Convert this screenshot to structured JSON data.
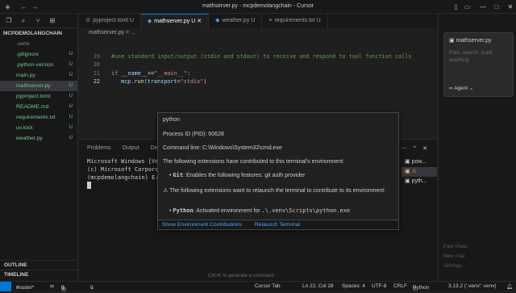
{
  "window": {
    "title": "mathserver.py - mcpdemolangchain - Cursor"
  },
  "sidebar": {
    "header": "MCPDEMOLANGCHAIN",
    "files": [
      {
        "name": ".venv",
        "badge": ""
      },
      {
        "name": ".gitignore",
        "badge": "U"
      },
      {
        "name": ".python-version",
        "badge": "U"
      },
      {
        "name": "main.py",
        "badge": "U"
      },
      {
        "name": "mathserver.py",
        "badge": "U"
      },
      {
        "name": "pyproject.toml",
        "badge": "U"
      },
      {
        "name": "README.md",
        "badge": "U"
      },
      {
        "name": "requirements.txt",
        "badge": "U"
      },
      {
        "name": "uv.lock",
        "badge": "U"
      },
      {
        "name": "weather.py",
        "badge": "U"
      }
    ],
    "outline": "OUTLINE",
    "timeline": "TIMELINE"
  },
  "tabs": [
    {
      "name": "pyproject.toml",
      "badge": "U",
      "icon": "toml"
    },
    {
      "name": "mathserver.py",
      "badge": "U",
      "icon": "py"
    },
    {
      "name": "weather.py",
      "badge": "U",
      "icon": "py"
    },
    {
      "name": "requirements.txt",
      "badge": "U",
      "icon": "txt"
    }
  ],
  "breadcrumb": "mathserver.py > ...",
  "editor": {
    "line_numbers": [
      "19",
      "20",
      "21",
      "22"
    ],
    "comment": "#use standard input/output (stdin and stdout) to receive and respond to tool function calls",
    "line21": {
      "kw": "if",
      "id": "__name__",
      "op": "==",
      "st": "\"__main__\"",
      "end": ":"
    },
    "line22": {
      "id": "mcp",
      "fn": "run",
      "param": "transport",
      "st": "\"stdio\""
    }
  },
  "panel": {
    "tabs": [
      "Problems",
      "Output",
      "Debug"
    ],
    "terminal_lines": [
      "Microsoft Windows [Version",
      "(c) Microsoft Corporation.",
      "",
      "(mcpdemolangchain) E:\\"
    ],
    "terminals": [
      "pow...",
      "cmd",
      "pyth..."
    ]
  },
  "hover": {
    "name": "python",
    "pid": "Process ID (PID): 60628",
    "cmd": "Command line: C:\\Windows\\System32\\cmd.exe",
    "contrib_title": "The following extensions have contributed to this terminal's environment:",
    "git_label": "Git",
    "git_text": ": Enables the following features: git auth provider",
    "relaunch_title": "The following extensions want to relaunch the terminal to contribute to its environment:",
    "python_label": "Python",
    "python_text": ": Activated environment for",
    "python_path": ".\\.venv\\Scripts\\python.exe",
    "link1": "Show Environment Contributions",
    "link2": "Relaunch Terminal"
  },
  "chat": {
    "card_title": "mathserver.py",
    "placeholder": "Plan, search, build anything",
    "agent": "Agent",
    "footer_lines": [
      "Past chats",
      "New chat",
      "Settings"
    ]
  },
  "terminal_hint": "Ctrl+K to generate a command",
  "status": {
    "branch": "master*",
    "errors": "0",
    "warnings": "0",
    "ports": "0",
    "cursor_tab": "Cursor Tab",
    "position": "Ln 22, Col 28",
    "spaces": "Spaces: 4",
    "encoding": "UTF-8",
    "eol": "CRLF",
    "language": "Python",
    "interpreter": "3.13.2 ('.venv': venv)"
  }
}
